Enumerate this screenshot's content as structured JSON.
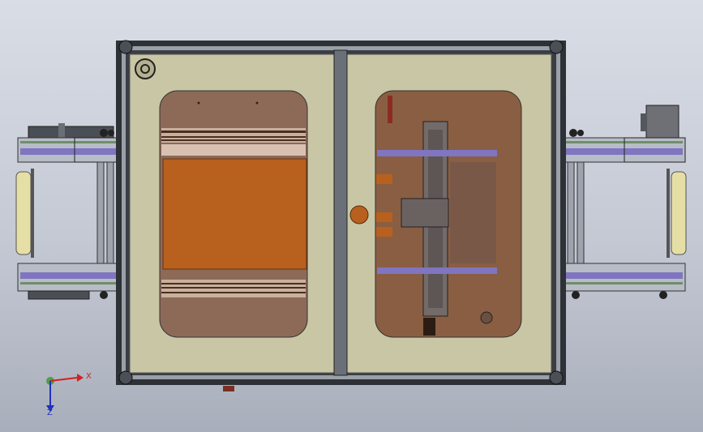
{
  "viewport": {
    "background": "gradient-grey"
  },
  "model": {
    "description_hidden": "",
    "colors": {
      "panel": "#c9c6a6",
      "frame": "#34383d",
      "conveyor_belt": "#7f75c0",
      "copper": "#a8541d",
      "interior": "#8a5a3e"
    }
  },
  "triad": {
    "x_label": "X",
    "z_label": "Z"
  }
}
